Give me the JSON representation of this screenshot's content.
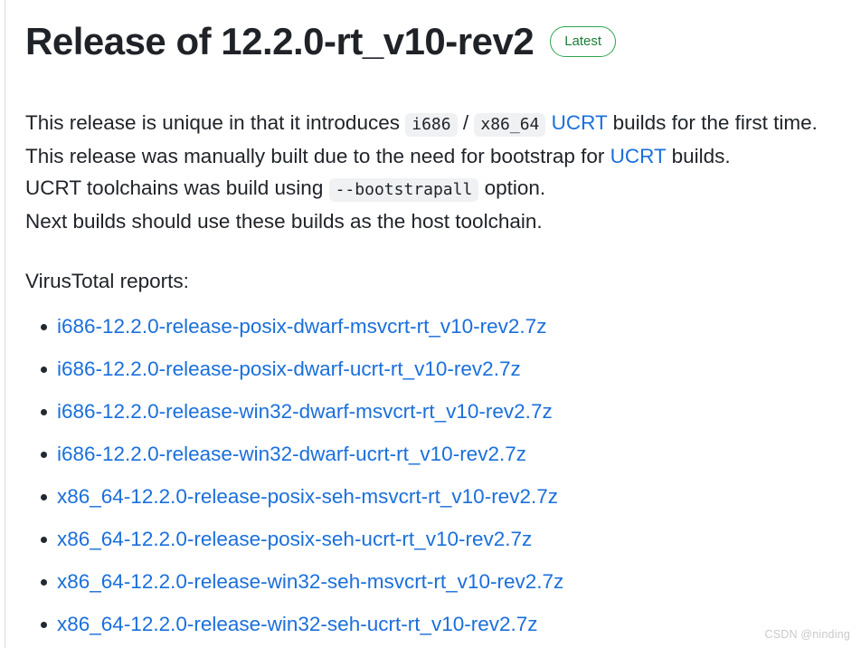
{
  "header": {
    "title": "Release of 12.2.0-rt_v10-rev2",
    "badge_label": "Latest",
    "badge_color": "#2da44e"
  },
  "colors": {
    "link": "#1a6fdb",
    "text": "#1f2328",
    "code_bg": "#eff1f3",
    "badge_border": "#2da44e",
    "badge_text": "#1a7f37",
    "watermark": "#c9c9c9"
  },
  "body": {
    "line1": {
      "part1": "This release is unique in that it introduces ",
      "code1": "i686",
      "separator": " / ",
      "code2": "x86_64",
      "space": " ",
      "link": "UCRT",
      "part2": " builds for the first time."
    },
    "line2": {
      "part1": "This release was manually built due to the need for bootstrap for ",
      "link": "UCRT",
      "part2": " builds."
    },
    "line3": {
      "part1": "UCRT toolchains was build using ",
      "code": "--bootstrapall",
      "part2": " option."
    },
    "line4": {
      "text": "Next builds should use these builds as the host toolchain."
    }
  },
  "reports": {
    "label": "VirusTotal reports:",
    "items": [
      {
        "label": "i686-12.2.0-release-posix-dwarf-msvcrt-rt_v10-rev2.7z"
      },
      {
        "label": "i686-12.2.0-release-posix-dwarf-ucrt-rt_v10-rev2.7z"
      },
      {
        "label": "i686-12.2.0-release-win32-dwarf-msvcrt-rt_v10-rev2.7z"
      },
      {
        "label": "i686-12.2.0-release-win32-dwarf-ucrt-rt_v10-rev2.7z"
      },
      {
        "label": "x86_64-12.2.0-release-posix-seh-msvcrt-rt_v10-rev2.7z"
      },
      {
        "label": "x86_64-12.2.0-release-posix-seh-ucrt-rt_v10-rev2.7z"
      },
      {
        "label": "x86_64-12.2.0-release-win32-seh-msvcrt-rt_v10-rev2.7z"
      },
      {
        "label": "x86_64-12.2.0-release-win32-seh-ucrt-rt_v10-rev2.7z"
      }
    ]
  },
  "watermark": {
    "text": "CSDN @ninding"
  }
}
